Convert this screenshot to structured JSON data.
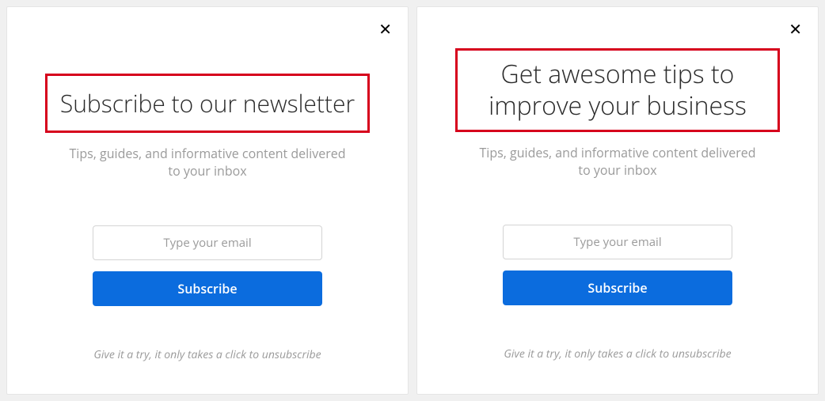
{
  "popups": [
    {
      "heading": "Subscribe to our newsletter",
      "subtitle": "Tips, guides, and informative content delivered to your inbox",
      "email_placeholder": "Type your email",
      "subscribe_label": "Subscribe",
      "footnote": "Give it a try, it only takes a click to unsubscribe"
    },
    {
      "heading": "Get awesome tips to improve your business",
      "subtitle": "Tips, guides, and informative content delivered to your inbox",
      "email_placeholder": "Type your email",
      "subscribe_label": "Subscribe",
      "footnote": "Give it a try, it only takes a click to unsubscribe"
    }
  ]
}
